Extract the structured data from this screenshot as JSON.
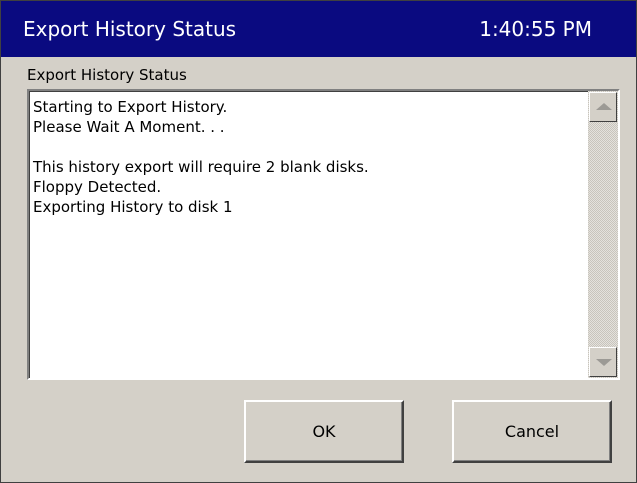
{
  "window": {
    "title": "Export History Status",
    "clock": "1:40:55 PM"
  },
  "section_label": "Export History Status",
  "status_lines": [
    "Starting to Export History.",
    "Please Wait A Moment. . .",
    "",
    "This history export will require 2 blank disks.",
    "Floppy Detected.",
    "Exporting History to disk 1"
  ],
  "buttons": {
    "ok_label": "OK",
    "cancel_label": "Cancel"
  },
  "colors": {
    "titlebar": "#0a0a80",
    "window_face": "#d4d0c8",
    "textbox": "#ffffff"
  },
  "icons": {
    "scroll_up": "chevron-up-icon",
    "scroll_down": "chevron-down-icon"
  }
}
